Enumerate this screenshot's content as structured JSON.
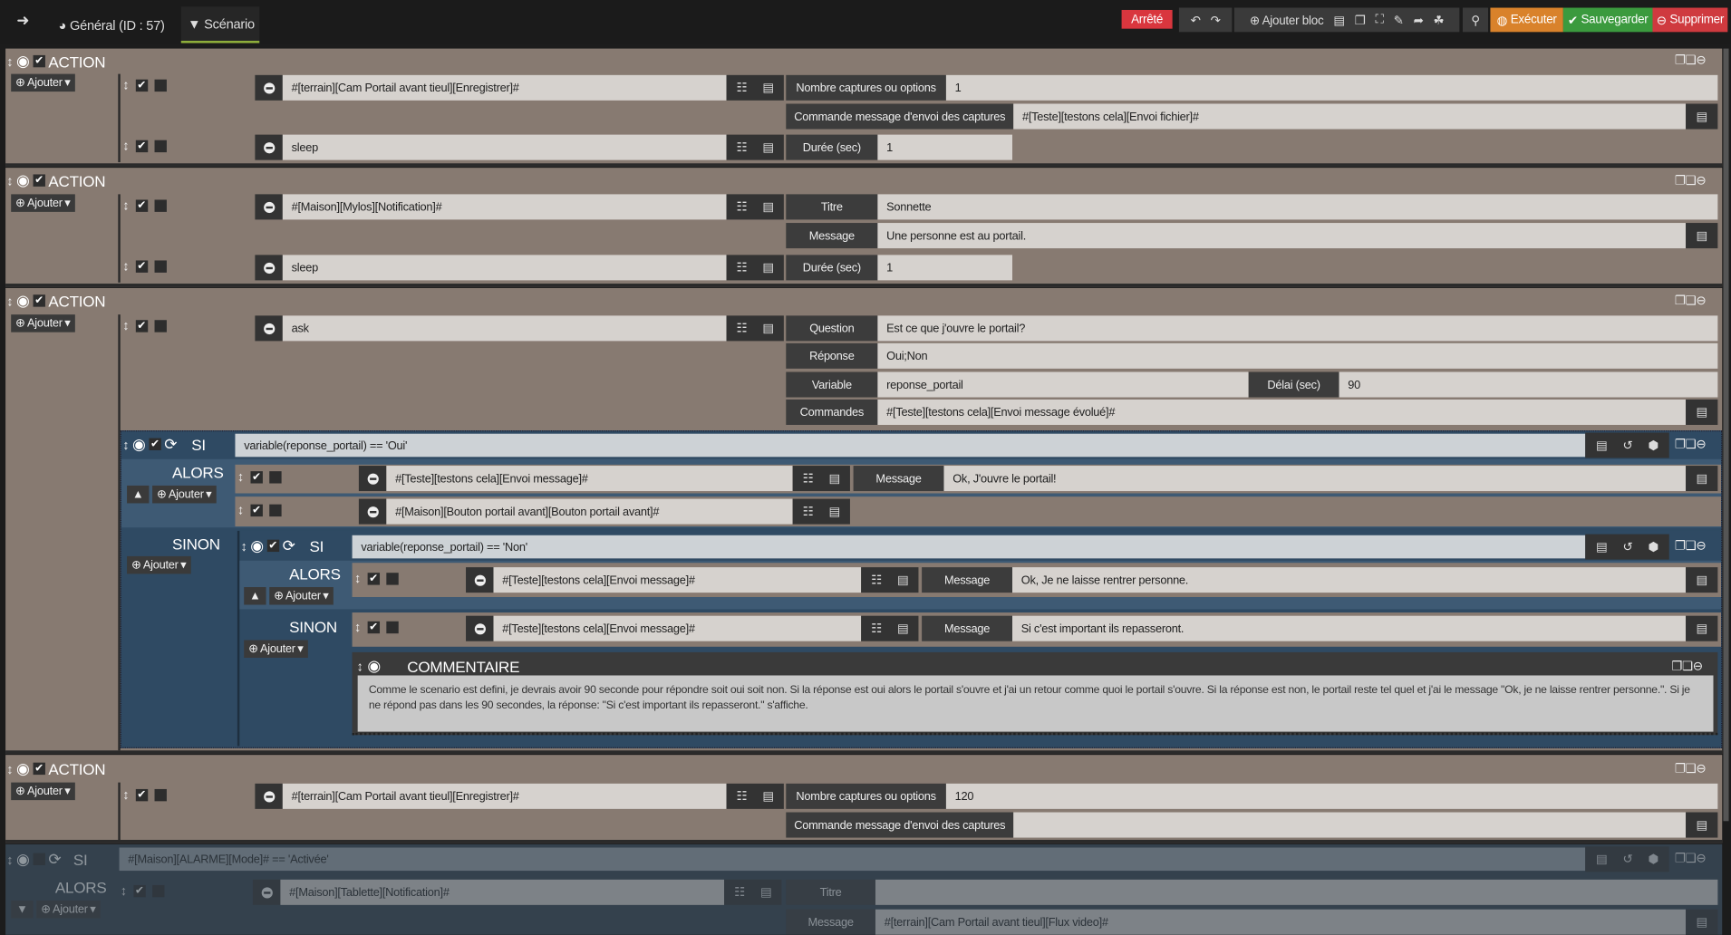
{
  "topbar": {
    "tab_general": "Général (ID : 57)",
    "tab_scenario": "Scénario",
    "status": "Arrêté",
    "add_block": "Ajouter bloc",
    "execute": "Exécuter",
    "save": "Sauvegarder",
    "delete": "Supprimer"
  },
  "colors": {
    "status": "#d9363e",
    "execute": "#d9822b",
    "save": "#3b9a3e",
    "delete": "#cf3a3f",
    "block": "#877a71",
    "si": "#2f4a63"
  },
  "common": {
    "action": "ACTION",
    "add": "Ajouter",
    "si": "SI",
    "alors": "ALORS",
    "sinon": "SINON",
    "comment": "COMMENTAIRE"
  },
  "block1": {
    "row1": {
      "cmd": "#[terrain][Cam Portail avant tieul][Enregistrer]#",
      "opt1_label": "Nombre captures ou options",
      "opt1_value": "1",
      "opt2_label": "Commande message d'envoi des captures",
      "opt2_value": "#[Teste][testons cela][Envoi fichier]#"
    },
    "row2": {
      "cmd": "sleep",
      "opt1_label": "Durée (sec)",
      "opt1_value": "1"
    }
  },
  "block2": {
    "row1": {
      "cmd": "#[Maison][Mylos][Notification]#",
      "opt1_label": "Titre",
      "opt1_value": "Sonnette",
      "opt2_label": "Message",
      "opt2_value": "Une personne est au portail."
    },
    "row2": {
      "cmd": "sleep",
      "opt1_label": "Durée (sec)",
      "opt1_value": "1"
    }
  },
  "block3": {
    "row1": {
      "cmd": "ask",
      "question_label": "Question",
      "question_value": "Est ce que j'ouvre le portail?",
      "answer_label": "Réponse",
      "answer_value": "Oui;Non",
      "variable_label": "Variable",
      "variable_value": "reponse_portail",
      "delay_label": "Délai (sec)",
      "delay_value": "90",
      "commands_label": "Commandes",
      "commands_value": "#[Teste][testons cela][Envoi message évolué]#"
    },
    "si1": {
      "condition": "variable(reponse_portail) == 'Oui'",
      "alors_row1": {
        "cmd": "#[Teste][testons cela][Envoi message]#",
        "opt_label": "Message",
        "opt_value": "Ok, J'ouvre le portail!"
      },
      "alors_row2": {
        "cmd": "#[Maison][Bouton portail avant][Bouton portail avant]#"
      }
    },
    "si2": {
      "condition": "variable(reponse_portail) == 'Non'",
      "alors_row": {
        "cmd": "#[Teste][testons cela][Envoi message]#",
        "opt_label": "Message",
        "opt_value": "Ok, Je ne laisse rentrer personne."
      },
      "sinon_row": {
        "cmd": "#[Teste][testons cela][Envoi message]#",
        "opt_label": "Message",
        "opt_value": "Si c'est important ils repasseront."
      },
      "comment": "Comme le scenario est defini, je devrais avoir 90 seconde pour répondre soit oui soit non. Si la réponse est oui alors le portail s'ouvre et j'ai un retour comme quoi le portail s'ouvre. Si la réponse est non, le portail reste tel quel et j'ai le message \"Ok, je ne laisse rentrer personne.\". Si je ne répond pas dans les 90 secondes, la réponse: \"Si c'est important ils repasseront.\" s'affiche."
    }
  },
  "block4": {
    "row1": {
      "cmd": "#[terrain][Cam Portail avant tieul][Enregistrer]#",
      "opt1_label": "Nombre captures ou options",
      "opt1_value": "120",
      "opt2_label": "Commande message d'envoi des captures",
      "opt2_value": ""
    }
  },
  "block5": {
    "condition": "#[Maison][ALARME][Mode]# == 'Activée'",
    "row1": {
      "cmd": "#[Maison][Tablette][Notification]#",
      "opt1_label": "Titre",
      "opt1_value": "",
      "opt2_label": "Message",
      "opt2_value": "#[terrain][Cam Portail avant tieul][Flux video]#"
    }
  }
}
